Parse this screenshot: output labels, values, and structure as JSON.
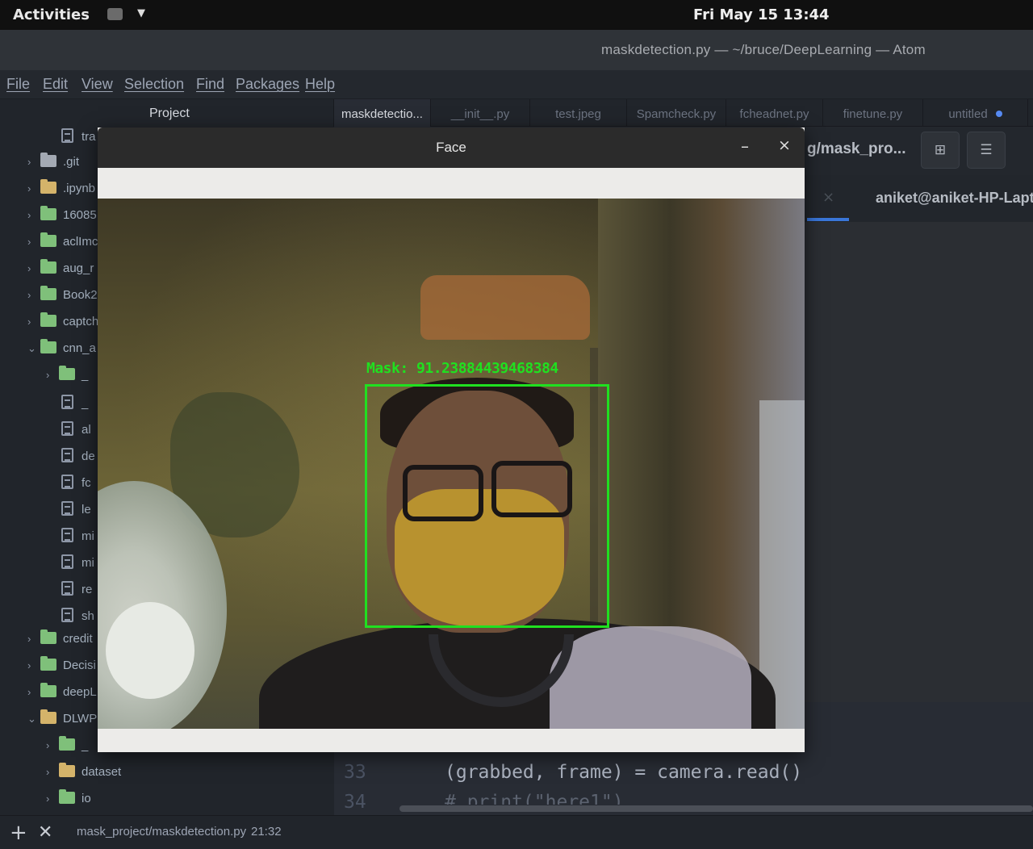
{
  "system": {
    "activities": "Activities",
    "clock": "Fri May 15  13:44"
  },
  "atom": {
    "window_title": "maskdetection.py — ~/bruce/DeepLearning — Atom",
    "menu": [
      "File",
      "Edit",
      "View",
      "Selection",
      "Find",
      "Packages",
      "Help"
    ],
    "tree": {
      "header": "Project",
      "rows": [
        {
          "label": "tra",
          "kind": "file"
        },
        {
          "label": ".git",
          "kind": "folder"
        },
        {
          "label": ".ipynb",
          "kind": "folder-open"
        },
        {
          "label": "16085",
          "kind": "folder-green"
        },
        {
          "label": "aclImc",
          "kind": "folder-green"
        },
        {
          "label": "aug_r",
          "kind": "folder-green"
        },
        {
          "label": "Book2",
          "kind": "folder-green"
        },
        {
          "label": "captch",
          "kind": "folder-green"
        },
        {
          "label": "cnn_a",
          "kind": "folder-green"
        },
        {
          "label": "_",
          "kind": "folder-green"
        },
        {
          "label": "_",
          "kind": "file"
        },
        {
          "label": "al",
          "kind": "file"
        },
        {
          "label": "de",
          "kind": "file"
        },
        {
          "label": "fc",
          "kind": "file"
        },
        {
          "label": "le",
          "kind": "file"
        },
        {
          "label": "mi",
          "kind": "file"
        },
        {
          "label": "mi",
          "kind": "file"
        },
        {
          "label": "re",
          "kind": "file"
        },
        {
          "label": "sh",
          "kind": "file"
        },
        {
          "label": "credit",
          "kind": "folder-green"
        },
        {
          "label": "Decisi",
          "kind": "folder-green"
        },
        {
          "label": "deepL",
          "kind": "folder-green"
        },
        {
          "label": "DLWP",
          "kind": "folder-open"
        },
        {
          "label": "_",
          "kind": "folder-green"
        },
        {
          "label": "dataset",
          "kind": "folder-open"
        },
        {
          "label": "io",
          "kind": "folder-green"
        }
      ]
    },
    "tabs": [
      "maskdetectio...",
      "__init__.py",
      "test.jpeg",
      "Spamcheck.py",
      "fcheadnet.py",
      "finetune.py",
      "untitled"
    ],
    "terminal": {
      "path": "g/mask_pro...",
      "split_icon": "⊞",
      "menu_icon": "☰",
      "tab_label": "aniket@aniket-HP-Lapt"
    },
    "code": {
      "lines": [
        {
          "num": "33",
          "text": "(grabbed, frame) = camera.read()"
        },
        {
          "num": "34",
          "text": "# print(\"here1\")"
        }
      ]
    },
    "status": {
      "file": "mask_project/maskdetection.py",
      "position": "21:32"
    }
  },
  "face_window": {
    "title": "Face",
    "minimize": "–",
    "close": "×",
    "detection_label": "Mask: 91.23884439468384"
  }
}
